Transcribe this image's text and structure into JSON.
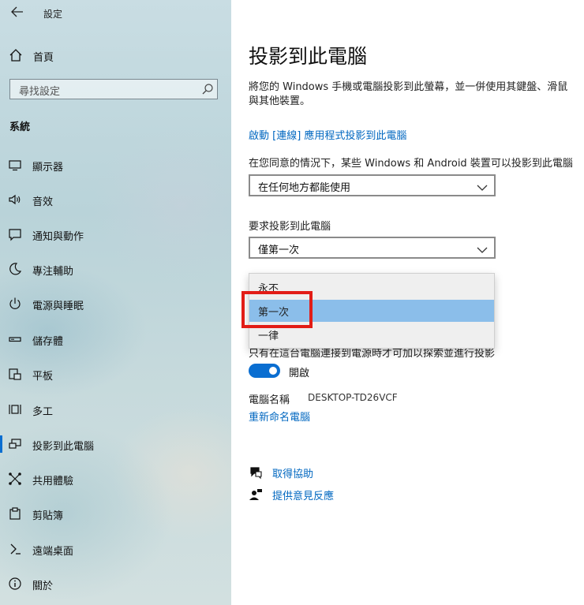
{
  "window": {
    "title": "設定",
    "back_icon": "back-arrow-icon"
  },
  "sidebar": {
    "home_label": "首頁",
    "search_placeholder": "尋找設定",
    "section_label": "系統",
    "items": [
      {
        "label": "顯示器",
        "icon": "monitor-icon"
      },
      {
        "label": "音效",
        "icon": "speaker-icon"
      },
      {
        "label": "通知與動作",
        "icon": "notification-icon"
      },
      {
        "label": "專注輔助",
        "icon": "moon-icon"
      },
      {
        "label": "電源與睡眠",
        "icon": "power-icon"
      },
      {
        "label": "儲存體",
        "icon": "storage-icon"
      },
      {
        "label": "平板",
        "icon": "tablet-icon"
      },
      {
        "label": "多工",
        "icon": "multitask-icon"
      },
      {
        "label": "投影到此電腦",
        "icon": "project-icon",
        "active": true
      },
      {
        "label": "共用體驗",
        "icon": "shared-icon"
      },
      {
        "label": "剪貼簿",
        "icon": "clipboard-icon"
      },
      {
        "label": "遠端桌面",
        "icon": "remote-desktop-icon"
      },
      {
        "label": "關於",
        "icon": "info-icon"
      }
    ]
  },
  "main": {
    "title": "投影到此電腦",
    "description": "將您的 Windows 手機或電腦投影到此螢幕，並一併使用其鍵盤、滑鼠與其他裝置。",
    "launch_link": "啟動 [連線] 應用程式投影到此電腦",
    "availability_caption": "在您同意的情況下，某些 Windows 和 Android 裝置可以投影到此電腦",
    "availability_value": "在任何地方都能使用",
    "pin_caption": "要求投影到此電腦",
    "pin_value": "僅第一次",
    "dropdown_options": [
      "永不",
      "第一次",
      "一律"
    ],
    "dropdown_selected": "第一次",
    "power_caption": "只有在這台電腦連接到電源時才可加以探索並進行投影",
    "toggle_label": "開啟",
    "toggle_on": true,
    "pc_name_label": "電腦名稱",
    "pc_name_value": "DESKTOP-TD26VCF",
    "rename_link": "重新命名電腦",
    "help_link": "取得協助",
    "feedback_link": "提供意見反應"
  },
  "colors": {
    "accent": "#0a6ed1",
    "link": "#0067c0",
    "highlight_box": "#e21d17",
    "selected_option": "#8bbeea"
  }
}
